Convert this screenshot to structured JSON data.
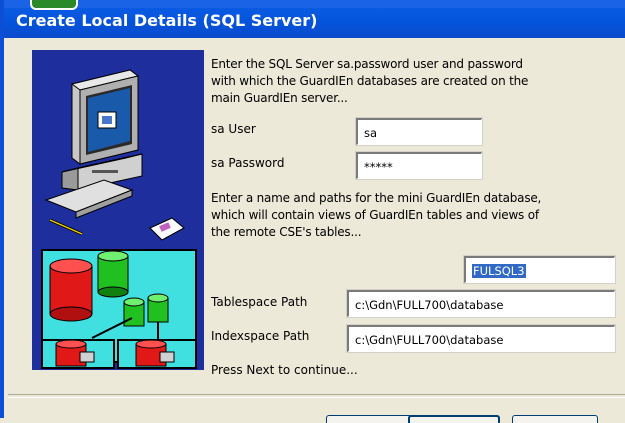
{
  "window": {
    "title": "Create Local Details (SQL Server)"
  },
  "intro": {
    "line1": "Enter the SQL Server sa.password user and password",
    "line2": "with which the GuardIEn databases are created on the",
    "line3": "main GuardIEn server..."
  },
  "credentials": {
    "user_label": "sa User",
    "user_value": "sa",
    "password_label": "sa Password",
    "password_value": "*****"
  },
  "mini_db": {
    "line1": "Enter a name and paths for the mini GuardIEn database,",
    "line2": "which will contain views of GuardIEn tables and views of",
    "line3": "the remote CSE's tables...",
    "name_value": "FULSQL3",
    "tablespace_label": "Tablespace Path",
    "tablespace_value": "c:\\Gdn\\FULL700\\database",
    "indexspace_label": "Indexspace Path",
    "indexspace_value": "c:\\Gdn\\FULL700\\database"
  },
  "footer": {
    "hint": "Press Next to continue..."
  },
  "icons": [
    "computer-illustration",
    "database-cylinder-icon",
    "wizard-side-graphic"
  ],
  "colors": {
    "titlebar": "#0553DB",
    "dialog_bg": "#ECE9D8",
    "art_bg": "#1E2E9C",
    "selection": "#316AC5"
  }
}
